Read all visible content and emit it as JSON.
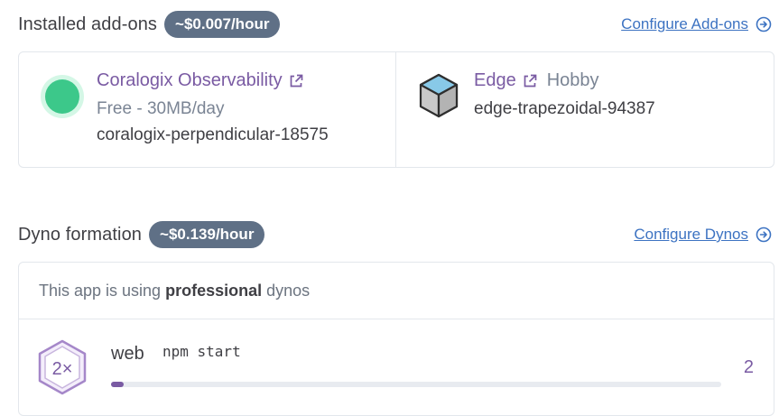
{
  "addons_section": {
    "title": "Installed add-ons",
    "cost": "~$0.007/hour",
    "configure_label": "Configure Add-ons"
  },
  "addons": [
    {
      "name": "Coralogix Observability",
      "plan": "Free - 30MB/day",
      "id": "coralogix-perpendicular-18575",
      "logo_icon": "coralogix-logo-icon",
      "external_icon": "external-link-icon"
    },
    {
      "name": "Edge",
      "plan": "Hobby",
      "id": "edge-trapezoidal-94387",
      "logo_icon": "edge-cube-icon",
      "external_icon": "external-link-icon"
    }
  ],
  "dynos_section": {
    "title": "Dyno formation",
    "cost": "~$0.139/hour",
    "configure_label": "Configure Dynos",
    "note_prefix": "This app is using",
    "note_bold": "professional",
    "note_suffix": "dynos"
  },
  "dynos": [
    {
      "badge": "2×",
      "type": "web",
      "command": "npm start",
      "quantity": "2",
      "scale_fraction": 0.02
    }
  ],
  "colors": {
    "link": "#3d73c2",
    "addon_name": "#7a5ba3",
    "cost_pill": "#5f7086",
    "coralogix_green": "#3cc88a",
    "edge_blue": "#88c9e8"
  }
}
